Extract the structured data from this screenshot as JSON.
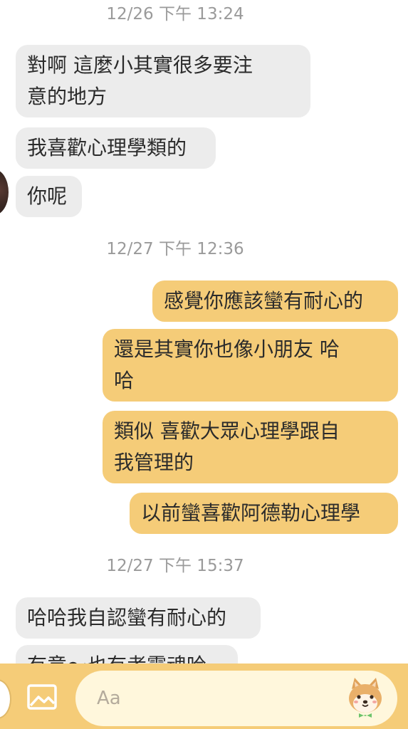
{
  "timestamps": [
    "12/26 下午 13:24",
    "12/27 下午 12:36",
    "12/27 下午 15:37"
  ],
  "messages": [
    {
      "side": "in",
      "text": "對啊 這麼小其實很多要注\n意的地方"
    },
    {
      "side": "in",
      "text": "我喜歡心理學類的"
    },
    {
      "side": "in",
      "text": "你呢"
    },
    {
      "side": "out",
      "text": "感覺你應該蠻有耐心的"
    },
    {
      "side": "out",
      "text": "還是其實你也像小朋友 哈\n哈"
    },
    {
      "side": "out",
      "text": "類似 喜歡大眾心理學跟自\n我管理的"
    },
    {
      "side": "out",
      "text": "以前蠻喜歡阿德勒心理學"
    },
    {
      "side": "in",
      "text": "哈哈我自認蠻有耐心的"
    },
    {
      "side": "in",
      "text": "有意～也有考靈魂哈"
    }
  ],
  "composer": {
    "placeholder": "Aa",
    "image_icon": "image-icon",
    "sticker_icon": "shiba-dog-sticker-icon"
  },
  "colors": {
    "incoming_bubble": "#ececec",
    "outgoing_bubble": "#f5cc78",
    "timestamp_text": "#9a9a9a",
    "bottom_bar": "#f5cc78",
    "input_background": "#fff7dc"
  }
}
